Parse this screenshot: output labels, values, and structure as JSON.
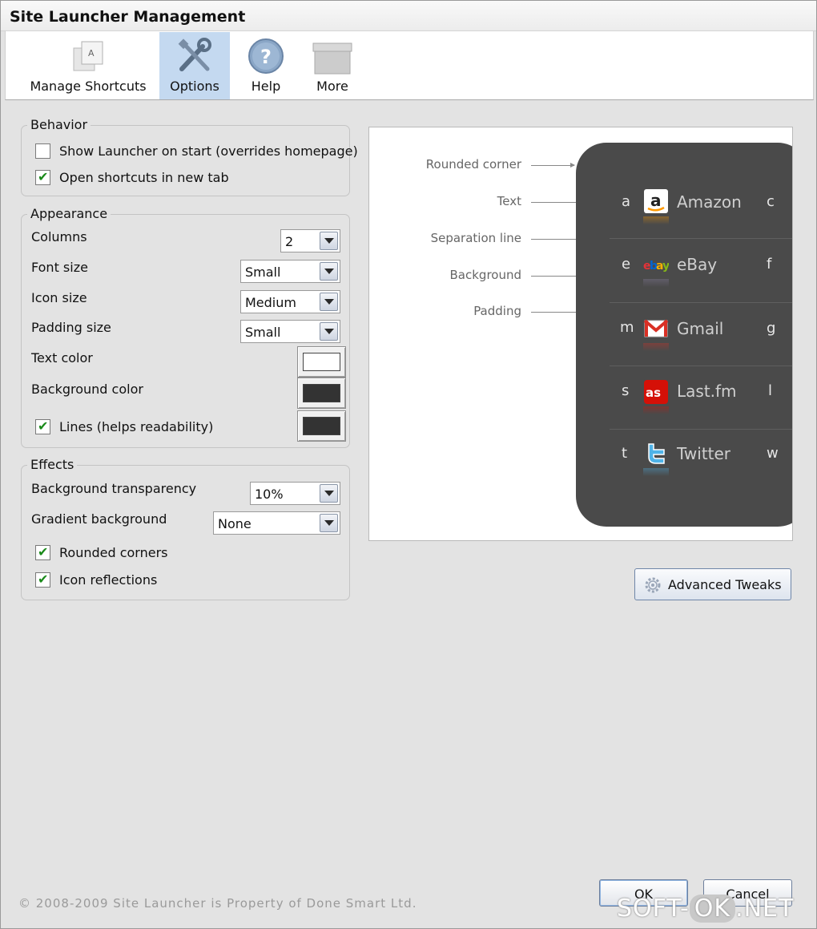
{
  "window": {
    "title": "Site Launcher Management"
  },
  "toolbar": {
    "items": [
      {
        "label": "Manage Shortcuts",
        "icon": "manage-shortcuts-icon",
        "active": false
      },
      {
        "label": "Options",
        "icon": "tools-icon",
        "active": true
      },
      {
        "label": "Help",
        "icon": "help-icon",
        "active": false
      },
      {
        "label": "More",
        "icon": "more-icon",
        "active": false
      }
    ]
  },
  "behavior": {
    "title": "Behavior",
    "show_launcher": {
      "label": "Show Launcher on start (overrides homepage)",
      "checked": false
    },
    "open_new_tab": {
      "label": "Open shortcuts in new tab",
      "checked": true
    }
  },
  "appearance": {
    "title": "Appearance",
    "columns": {
      "label": "Columns",
      "value": "2"
    },
    "font_size": {
      "label": "Font size",
      "value": "Small"
    },
    "icon_size": {
      "label": "Icon size",
      "value": "Medium"
    },
    "padding_size": {
      "label": "Padding size",
      "value": "Small"
    },
    "text_color": {
      "label": "Text color",
      "color": "#ffffff"
    },
    "background_color": {
      "label": "Background color",
      "color": "#333333"
    },
    "lines": {
      "label": "Lines (helps readability)",
      "checked": true,
      "color": "#333333"
    }
  },
  "effects": {
    "title": "Effects",
    "bg_transparency": {
      "label": "Background transparency",
      "value": "10%"
    },
    "gradient_bg": {
      "label": "Gradient background",
      "value": "None"
    },
    "rounded_corners": {
      "label": "Rounded corners",
      "checked": true
    },
    "icon_reflections": {
      "label": "Icon reflections",
      "checked": true
    }
  },
  "preview": {
    "annotations": [
      "Rounded corner",
      "Text",
      "Separation line",
      "Background",
      "Padding"
    ],
    "rows": [
      {
        "left_key": "a",
        "name": "Amazon",
        "right_key": "c",
        "icon": "amazon-icon"
      },
      {
        "left_key": "e",
        "name": "eBay",
        "right_key": "f",
        "icon": "ebay-icon"
      },
      {
        "left_key": "m",
        "name": "Gmail",
        "right_key": "g",
        "icon": "gmail-icon"
      },
      {
        "left_key": "s",
        "name": "Last.fm",
        "right_key": "l",
        "icon": "lastfm-icon"
      },
      {
        "left_key": "t",
        "name": "Twitter",
        "right_key": "w",
        "icon": "twitter-icon"
      }
    ]
  },
  "advanced_button": {
    "label": "Advanced Tweaks",
    "icon": "gear-icon"
  },
  "dialog_buttons": {
    "ok": "OK",
    "cancel": "Cancel"
  },
  "footer": {
    "copyright": "© 2008-2009 Site Launcher is Property of Done Smart Ltd."
  },
  "watermark": {
    "left": "SOFT-",
    "middle": "OK",
    "right": ".NET"
  }
}
